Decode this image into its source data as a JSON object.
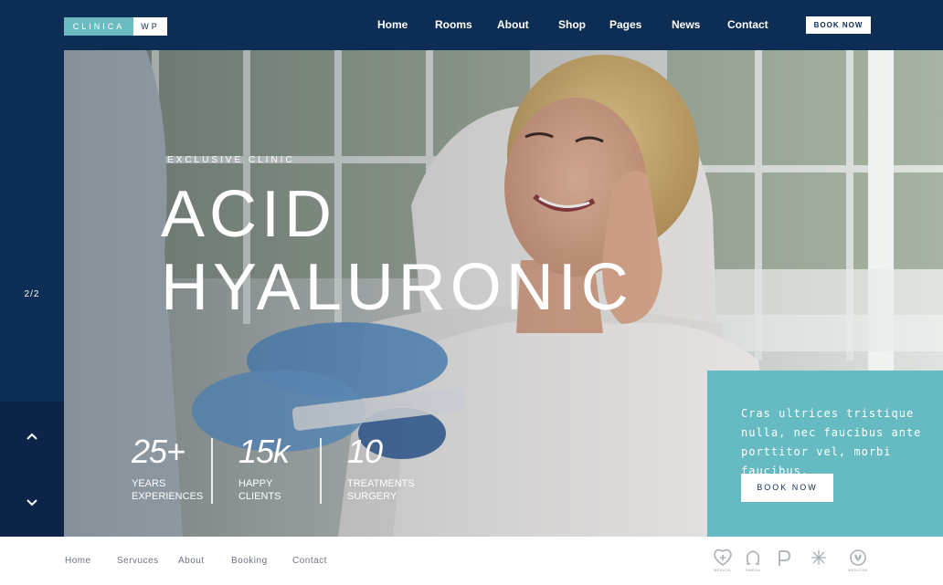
{
  "header": {
    "logo_part1": "CLINICA",
    "logo_part2": "WP",
    "nav": [
      "Home",
      "Rooms",
      "About",
      "Shop",
      "Pages",
      "News",
      "Contact"
    ],
    "book_label": "BOOK NOW"
  },
  "sidebar": {
    "slide_counter": "2/2"
  },
  "hero": {
    "eyebrow": "EXCLUSIVE CLINIC",
    "title_line1": "ACID",
    "title_line2": "HYALURONIC",
    "stats": [
      {
        "value": "25+",
        "label_line1": "YEARS",
        "label_line2": "EXPERIENCES"
      },
      {
        "value": "15k",
        "label_line1": "HAPPY",
        "label_line2": "CLIENTS"
      },
      {
        "value": "10",
        "label_line1": "TREATMENTS",
        "label_line2": "SURGERY"
      }
    ]
  },
  "info_box": {
    "text": "Cras ultrices tristique nulla, nec faucibus ante porttitor vel, morbi faucibus.",
    "button_label": "BOOK NOW"
  },
  "footer": {
    "links": [
      "Home",
      "Servuces",
      "About",
      "Booking",
      "Contact"
    ],
    "brands": [
      {
        "icon": "medical-logo-icon",
        "caption": "MEDICAL"
      },
      {
        "icon": "omega-pharma-logo-icon",
        "caption": "OMEGA"
      },
      {
        "icon": "p-pharmacy-logo-icon",
        "caption": ""
      },
      {
        "icon": "medical-team-logo-icon",
        "caption": ""
      },
      {
        "icon": "medicine-logo-icon",
        "caption": "MEDICINE"
      }
    ]
  },
  "colors": {
    "navy": "#0e2d55",
    "navy_dark": "#0b2448",
    "teal": "#65bbc1",
    "white": "#ffffff"
  }
}
